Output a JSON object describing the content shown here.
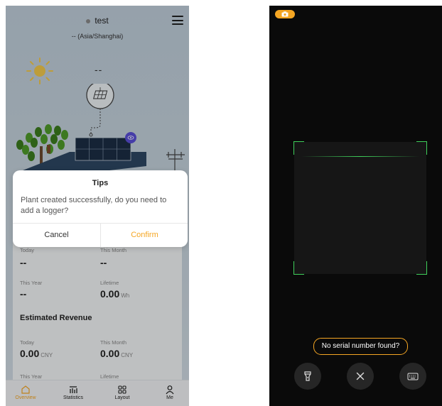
{
  "left_screen": {
    "header": {
      "plant_name": "test",
      "timezone": "-- (Asia/Shanghai)"
    },
    "weather": {
      "value": "--",
      "icon": "sun-icon"
    },
    "production": {
      "today_label": "Today",
      "today_value": "--",
      "month_label": "This Month",
      "month_value": "--",
      "year_label": "This Year",
      "year_value": "--",
      "lifetime_label": "Lifetime",
      "lifetime_value": "0.00",
      "lifetime_unit": "Wh"
    },
    "revenue": {
      "title": "Estimated Revenue",
      "today_label": "Today",
      "today_value": "0.00",
      "today_unit": "CNY",
      "month_label": "This Month",
      "month_value": "0.00",
      "month_unit": "CNY",
      "year_label": "This Year",
      "lifetime_label": "Lifetime"
    },
    "dialog": {
      "title": "Tips",
      "message": "Plant created successfully, do you need to add a logger?",
      "cancel_label": "Cancel",
      "confirm_label": "Confirm"
    },
    "tabbar": {
      "items": [
        {
          "label": "Overview",
          "icon": "home-icon",
          "active": true
        },
        {
          "label": "Statistics",
          "icon": "bar-chart-icon",
          "active": false
        },
        {
          "label": "Layout",
          "icon": "grid-icon",
          "active": false
        },
        {
          "label": "Me",
          "icon": "person-icon",
          "active": false
        }
      ]
    }
  },
  "right_screen": {
    "no_serial_label": "No serial number found?",
    "buttons": [
      "flashlight-icon",
      "close-icon",
      "keyboard-icon"
    ]
  },
  "colors": {
    "accent": "#f5a623",
    "scan_frame": "#3fcf5a",
    "panel_blue": "#2d4763",
    "tree_green": "#3c7d1e"
  }
}
